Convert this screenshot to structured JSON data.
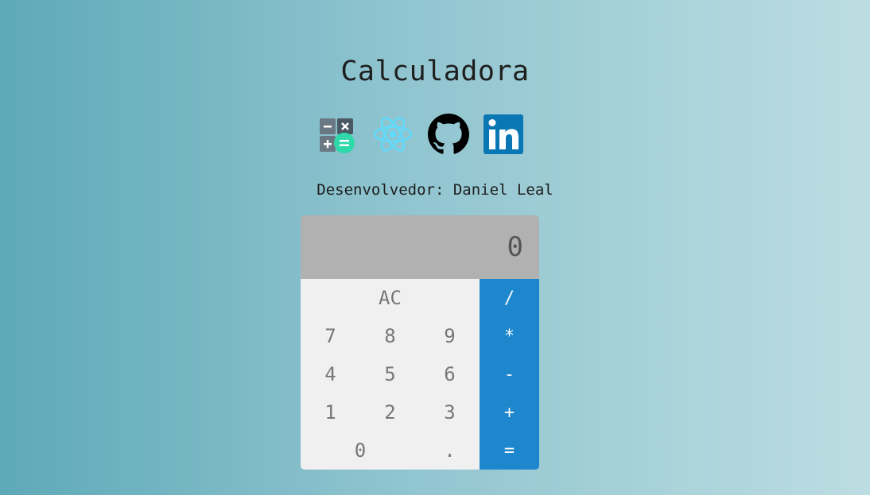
{
  "page": {
    "title": "Calculadora",
    "developer": "Desenvolvedor: Daniel Leal"
  },
  "icons": [
    "calculator-icon",
    "react-icon",
    "github-icon",
    "linkedin-icon"
  ],
  "colors": {
    "background_left": "#5ea9b8",
    "background_right": "#bcdde2",
    "display_bg": "#b1b1b1",
    "button_bg": "#f0f0f0",
    "operation_bg": "#1d86cc",
    "react_blue": "#61dafb",
    "linkedin_blue": "#0a77b5",
    "calc_green": "#2fd9a9"
  },
  "calculator": {
    "display": "0",
    "buttons": {
      "ac": "AC",
      "divide": "/",
      "seven": "7",
      "eight": "8",
      "nine": "9",
      "multiply": "*",
      "four": "4",
      "five": "5",
      "six": "6",
      "subtract": "-",
      "one": "1",
      "two": "2",
      "three": "3",
      "add": "+",
      "zero": "0",
      "decimal": ".",
      "equals": "="
    }
  }
}
